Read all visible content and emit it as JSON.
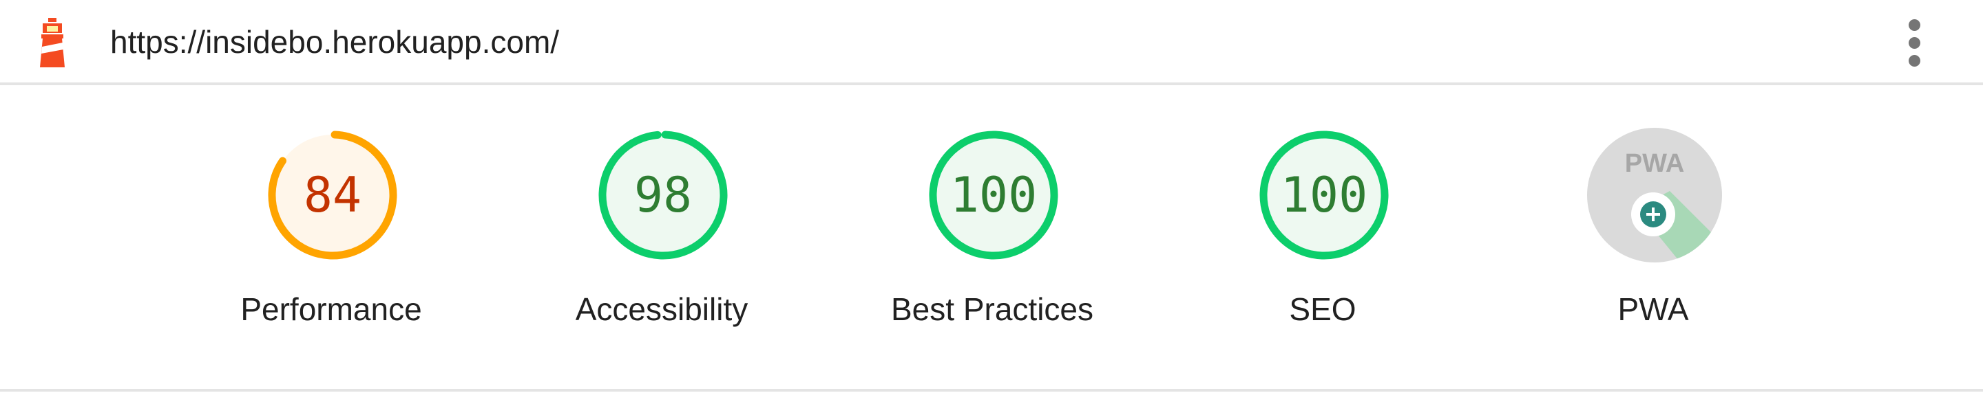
{
  "header": {
    "url": "https://insidebo.herokuapp.com/",
    "logo_icon": "lighthouse-icon",
    "menu_icon": "more-vertical-icon"
  },
  "colors": {
    "pass": "#0cce6b",
    "pass_text": "#2e7d32",
    "pass_bg": "#eef9f1",
    "average": "#ffa400",
    "average_text": "#c33300",
    "average_bg": "#fff6ea",
    "ring_track": "#e7e7e7"
  },
  "gauges": [
    {
      "score": 84,
      "score_text": "84",
      "label": "Performance",
      "rating": "average"
    },
    {
      "score": 98,
      "score_text": "98",
      "label": "Accessibility",
      "rating": "pass"
    },
    {
      "score": 100,
      "score_text": "100",
      "label": "Best Practices",
      "rating": "pass"
    },
    {
      "score": 100,
      "score_text": "100",
      "label": "SEO",
      "rating": "pass"
    }
  ],
  "pwa": {
    "label": "PWA",
    "badge_text": "PWA",
    "badge_icon": "pwa-badge-icon"
  }
}
